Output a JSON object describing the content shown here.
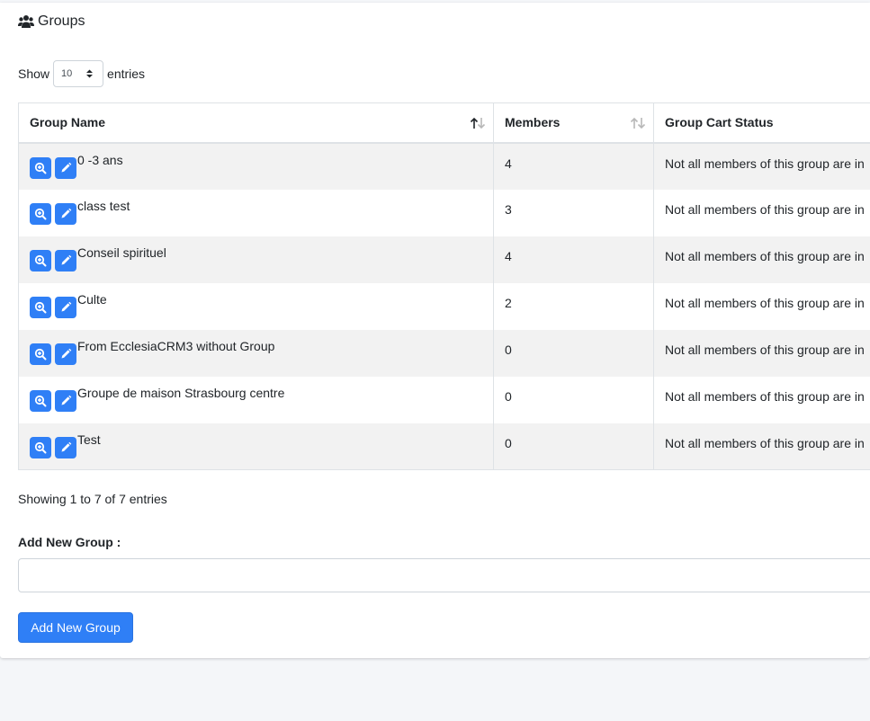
{
  "header": {
    "title": "Groups",
    "icon": "users-icon"
  },
  "length": {
    "show_label": "Show",
    "value": "10",
    "entries_label": "entries"
  },
  "table": {
    "columns": [
      "Group Name",
      "Members",
      "Group Cart Status"
    ],
    "rows": [
      {
        "name": "0 -3 ans",
        "members": "4",
        "status": "Not all members of this group are in"
      },
      {
        "name": "class test",
        "members": "3",
        "status": "Not all members of this group are in"
      },
      {
        "name": "Conseil spirituel",
        "members": "4",
        "status": "Not all members of this group are in"
      },
      {
        "name": "Culte",
        "members": "2",
        "status": "Not all members of this group are in"
      },
      {
        "name": "From EcclesiaCRM3 without Group",
        "members": "0",
        "status": "Not all members of this group are in"
      },
      {
        "name": "Groupe de maison Strasbourg centre",
        "members": "0",
        "status": "Not all members of this group are in"
      },
      {
        "name": "Test",
        "members": "0",
        "status": "Not all members of this group are in"
      }
    ]
  },
  "info": "Showing 1 to 7 of 7 entries",
  "add_group": {
    "label": "Add New Group :",
    "placeholder": "",
    "button": "Add New Group"
  },
  "colors": {
    "accent": "#2f7ff6",
    "stripe": "#f2f2f2",
    "background": "#f4f6f9"
  }
}
